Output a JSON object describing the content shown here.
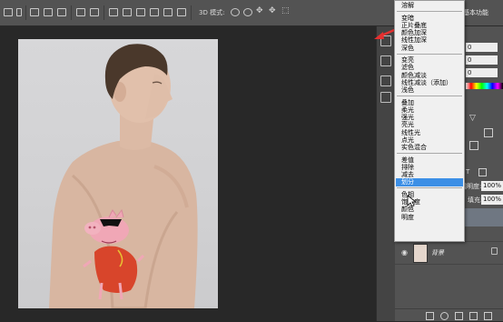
{
  "options_bar": {
    "mode_3d_label": "3D 模式:",
    "workspace_label": "基本功能"
  },
  "blend_menu": {
    "groups": [
      [
        "溶解"
      ],
      [
        "变暗",
        "正片叠底",
        "颜色加深",
        "线性加深",
        "深色"
      ],
      [
        "变亮",
        "滤色",
        "颜色减淡",
        "线性减淡（添加）",
        "浅色"
      ],
      [
        "叠加",
        "柔光",
        "强光",
        "亮光",
        "线性光",
        "点光",
        "实色混合"
      ],
      [
        "差值",
        "排除",
        "减去",
        "划分"
      ],
      [
        "色相",
        "饱和度",
        "颜色",
        "明度"
      ]
    ],
    "selected": "划分"
  },
  "layers": {
    "opacity_label": "不透明度:",
    "opacity_value": "100%",
    "fill_label": "填充:",
    "fill_value": "100%",
    "background_layer_name": "背景"
  },
  "colors": {
    "menu_highlight": "#3c8fe6",
    "arrow": "#e53030",
    "panel_bg": "#535353",
    "canvas_bg": "#282828"
  },
  "icons": [
    "move-icon",
    "align-left-icon",
    "align-center-icon",
    "align-right-icon",
    "distribute-icon",
    "orbit-3d-icon",
    "roll-3d-icon",
    "pan-3d-icon",
    "slide-3d-icon",
    "scale-3d-icon",
    "history-icon",
    "character-icon",
    "paragraph-icon",
    "brush-icon",
    "eye-icon",
    "lock-icon",
    "arrow-cursor-icon"
  ]
}
